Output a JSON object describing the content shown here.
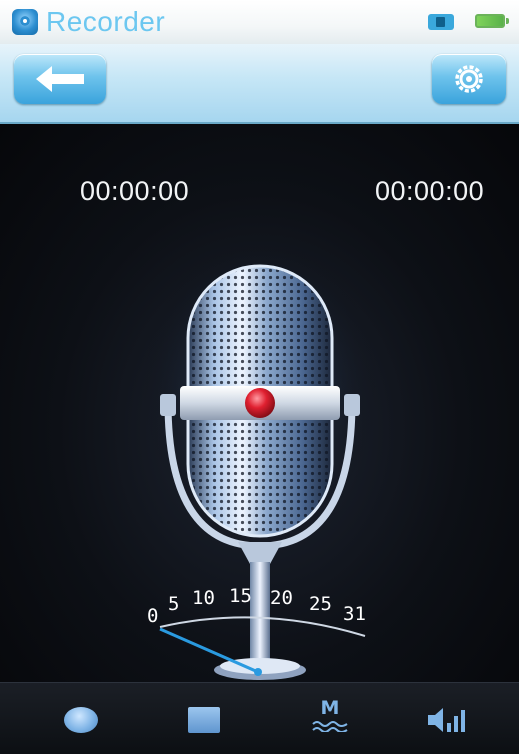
{
  "status_bar": {
    "app_title": "Recorder",
    "icons": [
      "recorder-app-icon",
      "sd-card-icon",
      "battery-icon"
    ]
  },
  "nav": {
    "back_icon": "back-arrow-icon",
    "settings_icon": "gear-icon"
  },
  "recorder": {
    "elapsed_time": "00:00:00",
    "total_time": "00:00:00",
    "level_meter": {
      "scale_labels": [
        "0",
        "5",
        "10",
        "15",
        "20",
        "25",
        "31"
      ],
      "level": 0
    }
  },
  "toolbar": {
    "items": [
      {
        "name": "record",
        "icon": "record-icon"
      },
      {
        "name": "stop",
        "icon": "stop-icon"
      },
      {
        "name": "mode",
        "label": "M",
        "icon": "mode-icon"
      },
      {
        "name": "volume",
        "icon": "volume-icon"
      }
    ]
  },
  "colors": {
    "accent_blue": "#6cc7f0",
    "meter_needle": "#2a9ae0",
    "mic_indicator_red": "#e02030"
  }
}
